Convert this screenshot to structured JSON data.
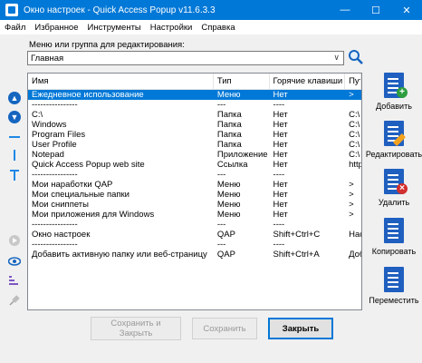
{
  "window": {
    "title": "Окно настроек - Quick Access Popup v11.6.3.3",
    "controls": {
      "minimize": "—",
      "maximize": "☐",
      "close": "✕"
    }
  },
  "menu": [
    "Файл",
    "Избранное",
    "Инструменты",
    "Настройки",
    "Справка"
  ],
  "menu_label": "Меню или группа для редактирования:",
  "combo": {
    "value": "Главная",
    "arrow": "∨"
  },
  "columns": [
    "Имя",
    "Тип",
    "Горячие клавиши",
    "Пут"
  ],
  "rows": [
    {
      "name": "Ежедневное использование",
      "type": "Меню",
      "hotkey": "Нет",
      "path": ">",
      "selected": true
    },
    {
      "name": "----------------",
      "type": "---",
      "hotkey": "----",
      "path": ""
    },
    {
      "name": "C:\\",
      "type": "Папка",
      "hotkey": "Нет",
      "path": "C:\\"
    },
    {
      "name": "Windows",
      "type": "Папка",
      "hotkey": "Нет",
      "path": "C:\\"
    },
    {
      "name": "Program Files",
      "type": "Папка",
      "hotkey": "Нет",
      "path": "C:\\"
    },
    {
      "name": "User Profile",
      "type": "Папка",
      "hotkey": "Нет",
      "path": "C:\\"
    },
    {
      "name": "Notepad",
      "type": "Приложение",
      "hotkey": "Нет",
      "path": "C:\\"
    },
    {
      "name": "Quick Access Popup web site",
      "type": "Ссылка",
      "hotkey": "Нет",
      "path": "http"
    },
    {
      "name": "----------------",
      "type": "---",
      "hotkey": "----",
      "path": ""
    },
    {
      "name": "Мои наработки QAP",
      "type": "Меню",
      "hotkey": "Нет",
      "path": ">"
    },
    {
      "name": "Мои специальные папки",
      "type": "Меню",
      "hotkey": "Нет",
      "path": ">"
    },
    {
      "name": "Мои сниппеты",
      "type": "Меню",
      "hotkey": "Нет",
      "path": ">"
    },
    {
      "name": "Мои приложения для Windows",
      "type": "Меню",
      "hotkey": "Нет",
      "path": ">"
    },
    {
      "name": "----------------",
      "type": "---",
      "hotkey": "----",
      "path": ""
    },
    {
      "name": "Окно настроек",
      "type": "QAP",
      "hotkey": "Shift+Ctrl+C",
      "path": "Нас"
    },
    {
      "name": "----------------",
      "type": "---",
      "hotkey": "----",
      "path": ""
    },
    {
      "name": "Добавить активную папку или веб-страницу",
      "type": "QAP",
      "hotkey": "Shift+Ctrl+A",
      "path": "Доб"
    }
  ],
  "actions": {
    "add": "Добавить",
    "edit": "Редактировать",
    "delete": "Удалить",
    "copy": "Копировать",
    "move": "Переместить"
  },
  "buttons": {
    "save_close": "Сохранить и Закрыть",
    "save": "Сохранить",
    "close": "Закрыть"
  },
  "colors": {
    "accent": "#0078d7",
    "add_badge": "#2e9e3f",
    "delete_badge": "#d32f2f"
  }
}
